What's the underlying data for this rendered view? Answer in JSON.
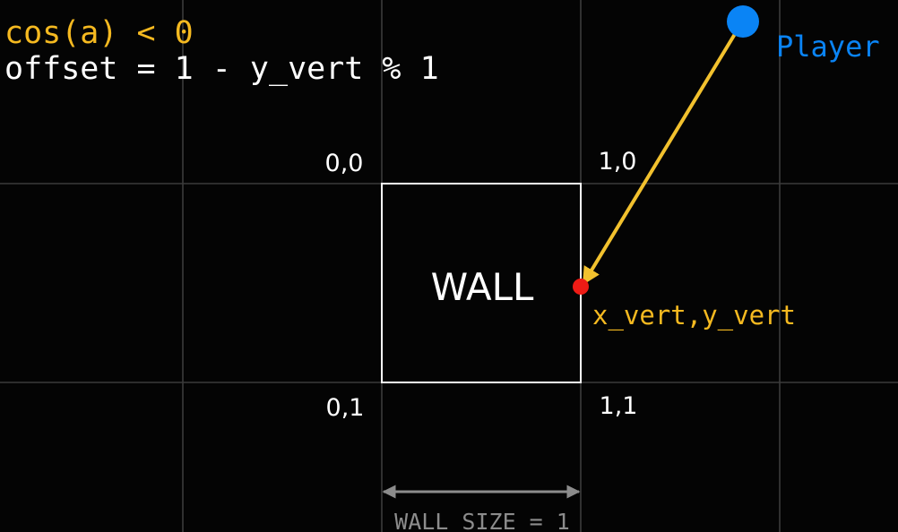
{
  "header": {
    "condition": "cos(a) < 0",
    "formula": "offset = 1 - y_vert % 1"
  },
  "labels": {
    "player": "Player",
    "wall": "WALL",
    "hit_point": "x_vert,y_vert",
    "wall_size": "WALL_SIZE = 1"
  },
  "corners": {
    "top_left": "0,0",
    "top_right": "1,0",
    "bottom_left": "0,1",
    "bottom_right": "1,1"
  },
  "colors": {
    "background": "#040404",
    "grid": "#3b3b3b",
    "wall": "#ffffff",
    "text": "#ffffff",
    "accent": "#f5b920",
    "ray": "#f2c12e",
    "player": "#0a84f5",
    "hit_point": "#ee1b15",
    "dimension": "#8c8c8c"
  }
}
